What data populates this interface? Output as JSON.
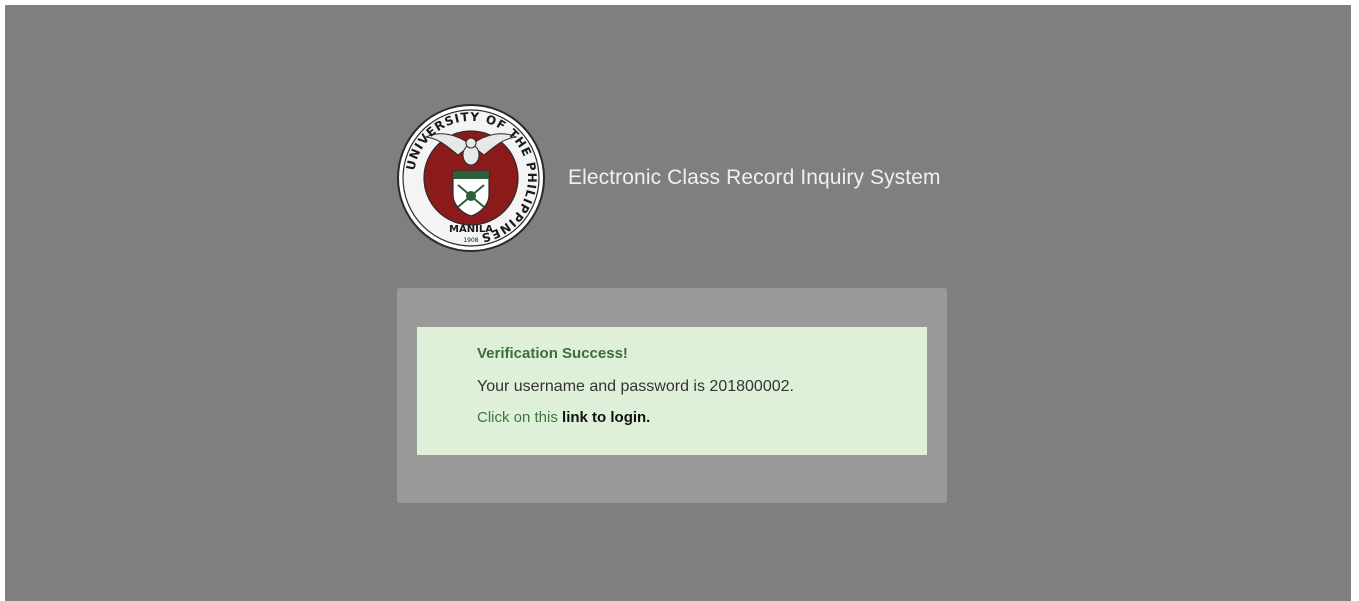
{
  "header": {
    "logo_ring_text": "UNIVERSITY OF THE PHILIPPINES",
    "logo_campus": "MANILA",
    "logo_year": "1908",
    "app_title": "Electronic Class Record Inquiry System"
  },
  "alert": {
    "title": "Verification Success!",
    "message": "Your username and password is 201800002.",
    "link_prefix": "Click on this",
    "link_label": "link to login."
  },
  "colors": {
    "background": "#7f7f7f",
    "panel": "#999999",
    "alert_bg": "#dff0d8",
    "alert_title": "#3c6e3c",
    "seal_red": "#8b1a1a",
    "seal_green": "#2e5e3a"
  }
}
